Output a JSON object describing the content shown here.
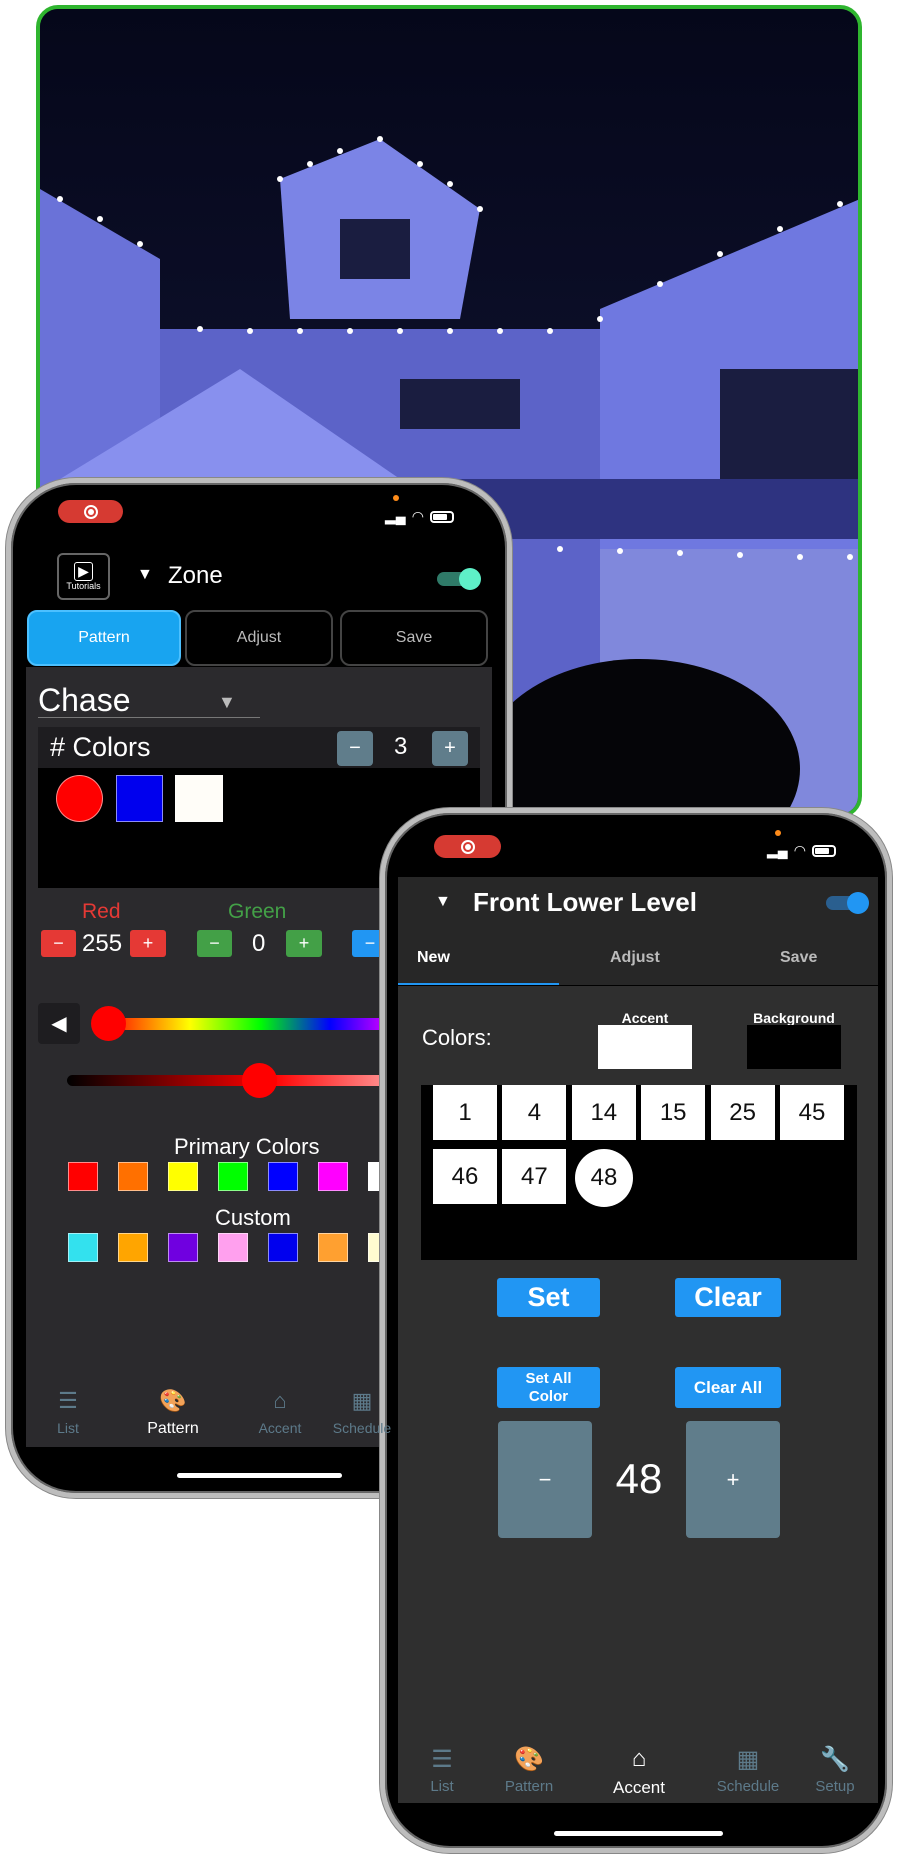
{
  "photo": {
    "border_color": "#2fb52f"
  },
  "phone1": {
    "tutorials_label": "Tutorials",
    "zone_title": "Zone",
    "toggle_on": true,
    "tabs": [
      {
        "label": "Pattern",
        "active": true
      },
      {
        "label": "Adjust"
      },
      {
        "label": "Save"
      }
    ],
    "pattern_select": "Chase",
    "num_colors_label": "# Colors",
    "num_colors_value": "3",
    "minus": "−",
    "plus": "+",
    "selected_colors": [
      "#ff0000",
      "#0000ee",
      "#fffdf8"
    ],
    "red": {
      "label": "Red",
      "value": "255"
    },
    "green": {
      "label": "Green",
      "value": "0"
    },
    "primary_label": "Primary Colors",
    "primary_colors": [
      "#ff0000",
      "#ff7000",
      "#ffff00",
      "#00ff00",
      "#0000ff",
      "#ff00ff",
      "#ffffff"
    ],
    "custom_label": "Custom",
    "custom_colors": [
      "#33e1ee",
      "#ffa500",
      "#7000e0",
      "#ffa0ee",
      "#0000ee",
      "#ffa030",
      "#fffbd0"
    ],
    "nav": [
      {
        "label": "List",
        "icon": "list-icon"
      },
      {
        "label": "Pattern",
        "icon": "palette-icon",
        "active": true
      },
      {
        "label": "Accent",
        "icon": "home-icon"
      },
      {
        "label": "Schedule",
        "icon": "calendar-icon"
      }
    ]
  },
  "phone2": {
    "zone_title": "Front Lower Level",
    "toggle_on": true,
    "tabs": [
      {
        "label": "New",
        "active": true
      },
      {
        "label": "Adjust"
      },
      {
        "label": "Save"
      }
    ],
    "colors_label": "Colors:",
    "accent_label": "Accent",
    "accent_color": "#ffffff",
    "background_label": "Background",
    "background_color": "#000000",
    "cells": [
      "1",
      "4",
      "14",
      "15",
      "25",
      "45",
      "46",
      "47",
      "48"
    ],
    "selected_cell": "48",
    "set_label": "Set",
    "clear_label": "Clear",
    "set_all_label_1": "Set All",
    "set_all_label_2": "Color",
    "clear_all_label": "Clear All",
    "minus": "−",
    "plus": "+",
    "counter_value": "48",
    "nav": [
      {
        "label": "List",
        "icon": "list-icon"
      },
      {
        "label": "Pattern",
        "icon": "palette-icon"
      },
      {
        "label": "Accent",
        "icon": "home-icon",
        "active": true
      },
      {
        "label": "Schedule",
        "icon": "calendar-icon"
      },
      {
        "label": "Setup",
        "icon": "wrench-icon"
      }
    ]
  }
}
